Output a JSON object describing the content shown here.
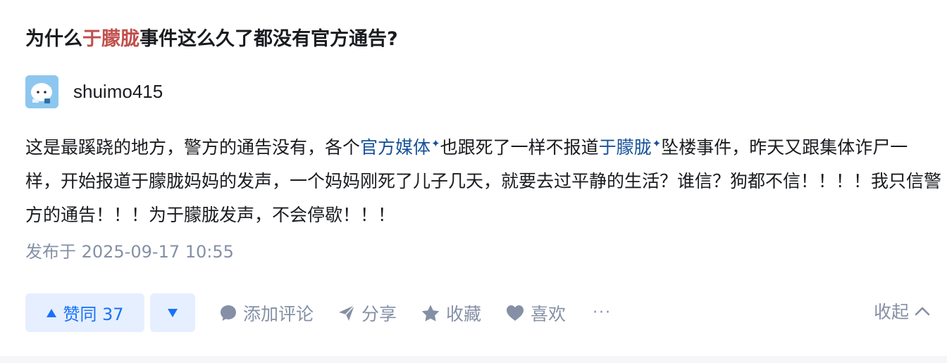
{
  "question": {
    "title_prefix": "为什么",
    "title_highlight": "于朦胧",
    "title_suffix": "事件这么久了都没有官方通告?"
  },
  "author": {
    "name": "shuimo415",
    "avatar_icon": "avatar-image"
  },
  "answer": {
    "line1_a": "这是最蹊跷的地方，警方的通告没有，各个",
    "link1": "官方媒体",
    "line1_b": "也跟死了一样不报道",
    "link2": "于朦胧",
    "line1_c": "坠楼事件，昨天又跟集体诈尸一样，开始报道于朦胧妈妈的发声，一个妈妈刚死了儿子几天，就要去过平静的生活？谁信？狗都不信！！！！我只信警方的通告！！！为于朦胧发声，不会停歇！！！",
    "spark_glyph": "✦"
  },
  "meta": {
    "published": "发布于 2025-09-17 10:55"
  },
  "actions": {
    "upvote_label": "赞同 37",
    "comment_label": "添加评论",
    "share_label": "分享",
    "favorite_label": "收藏",
    "like_label": "喜欢",
    "more_label": "···",
    "collapse_label": "收起"
  },
  "colors": {
    "highlight": "#c0504d",
    "link": "#175199",
    "accent": "#1772f6",
    "muted": "#8590a6"
  }
}
